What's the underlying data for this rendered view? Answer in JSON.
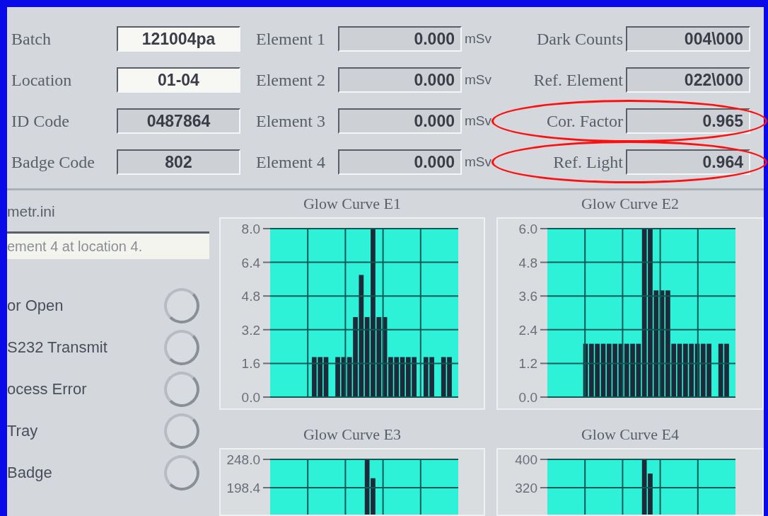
{
  "fields": [
    {
      "label": "Batch",
      "value": "121004pa",
      "kind": "control"
    },
    {
      "label": "Location",
      "value": "01-04",
      "kind": "control"
    },
    {
      "label": "ID Code",
      "value": "0487864",
      "kind": "indicator"
    },
    {
      "label": "Badge Code",
      "value": "802",
      "kind": "indicator"
    }
  ],
  "elements": [
    {
      "label": "Element 1",
      "value": "0.000",
      "unit": "mSv"
    },
    {
      "label": "Element 2",
      "value": "0.000",
      "unit": "mSv"
    },
    {
      "label": "Element 3",
      "value": "0.000",
      "unit": "mSv"
    },
    {
      "label": "Element 4",
      "value": "0.000",
      "unit": "mSv"
    }
  ],
  "readings": [
    {
      "label": "Dark Counts",
      "value": "004\\000",
      "highlighted": false
    },
    {
      "label": "Ref. Element",
      "value": "022\\000",
      "highlighted": false
    },
    {
      "label": "Cor. Factor",
      "value": "0.965",
      "highlighted": true
    },
    {
      "label": "Ref. Light",
      "value": "0.964",
      "highlighted": true
    }
  ],
  "file_label": "metr.ini",
  "message": "ement 4 at location 4.",
  "indicators": [
    {
      "label": "or Open",
      "on": false
    },
    {
      "label": "S232 Transmit",
      "on": false
    },
    {
      "label": "ocess Error",
      "on": false
    },
    {
      "label": "Tray",
      "on": false
    },
    {
      "label": "Badge",
      "on": false
    }
  ],
  "charts": [
    {
      "chart_data": {
        "type": "bar",
        "grid": true,
        "title": "Glow Curve E1",
        "ylim": [
          0,
          8
        ],
        "yticks": [
          {
            "value": 0,
            "label": "0.0"
          },
          {
            "value": 1.6,
            "label": "1.6"
          },
          {
            "value": 3.2,
            "label": "3.2"
          },
          {
            "value": 4.8,
            "label": "4.8"
          },
          {
            "value": 6.4,
            "label": "6.4"
          },
          {
            "value": 8,
            "label": "8.0"
          }
        ],
        "values": [
          0,
          0,
          0,
          0,
          0,
          0,
          0,
          1.9,
          1.9,
          1.9,
          0,
          1.9,
          1.9,
          1.9,
          3.8,
          5.8,
          3.8,
          8.0,
          3.8,
          3.8,
          1.9,
          1.9,
          1.9,
          1.9,
          1.9,
          0,
          1.9,
          1.9,
          0,
          1.9,
          1.9,
          0
        ]
      }
    },
    {
      "chart_data": {
        "type": "bar",
        "grid": true,
        "title": "Glow Curve E2",
        "ylim": [
          0,
          6
        ],
        "yticks": [
          {
            "value": 0,
            "label": "0.0"
          },
          {
            "value": 1.2,
            "label": "1.2"
          },
          {
            "value": 2.4,
            "label": "2.4"
          },
          {
            "value": 3.6,
            "label": "3.6"
          },
          {
            "value": 4.8,
            "label": "4.8"
          },
          {
            "value": 6,
            "label": "6.0"
          }
        ],
        "values": [
          0,
          0,
          0,
          0,
          0,
          0,
          1.9,
          1.9,
          1.9,
          1.9,
          1.9,
          1.9,
          1.9,
          1.9,
          1.9,
          1.9,
          6.0,
          6.0,
          3.8,
          3.8,
          3.8,
          1.9,
          1.9,
          1.9,
          1.9,
          1.9,
          1.9,
          1.9,
          0,
          1.9,
          1.9,
          0
        ]
      }
    },
    {
      "chart_data": {
        "type": "bar",
        "grid": true,
        "title": "Glow Curve E3",
        "ylim": [
          0,
          248
        ],
        "yticks": [
          {
            "value": 198.4,
            "label": "198.4"
          },
          {
            "value": 248,
            "label": "248.0"
          }
        ],
        "values": [
          0,
          0,
          0,
          0,
          0,
          0,
          0,
          0,
          0,
          0,
          0,
          0,
          0,
          0,
          0,
          0,
          248,
          215,
          0,
          0,
          0,
          0,
          0,
          0,
          0,
          0,
          0,
          0,
          0,
          0,
          0,
          0
        ]
      }
    },
    {
      "chart_data": {
        "type": "bar",
        "grid": true,
        "title": "Glow Curve E4",
        "ylim": [
          0,
          400
        ],
        "yticks": [
          {
            "value": 320,
            "label": "320"
          },
          {
            "value": 400,
            "label": "400"
          }
        ],
        "values": [
          0,
          0,
          0,
          0,
          0,
          0,
          0,
          0,
          0,
          0,
          0,
          0,
          0,
          0,
          0,
          0,
          400,
          360,
          0,
          0,
          0,
          0,
          0,
          0,
          0,
          0,
          0,
          0,
          0,
          0,
          0,
          0
        ]
      }
    }
  ]
}
